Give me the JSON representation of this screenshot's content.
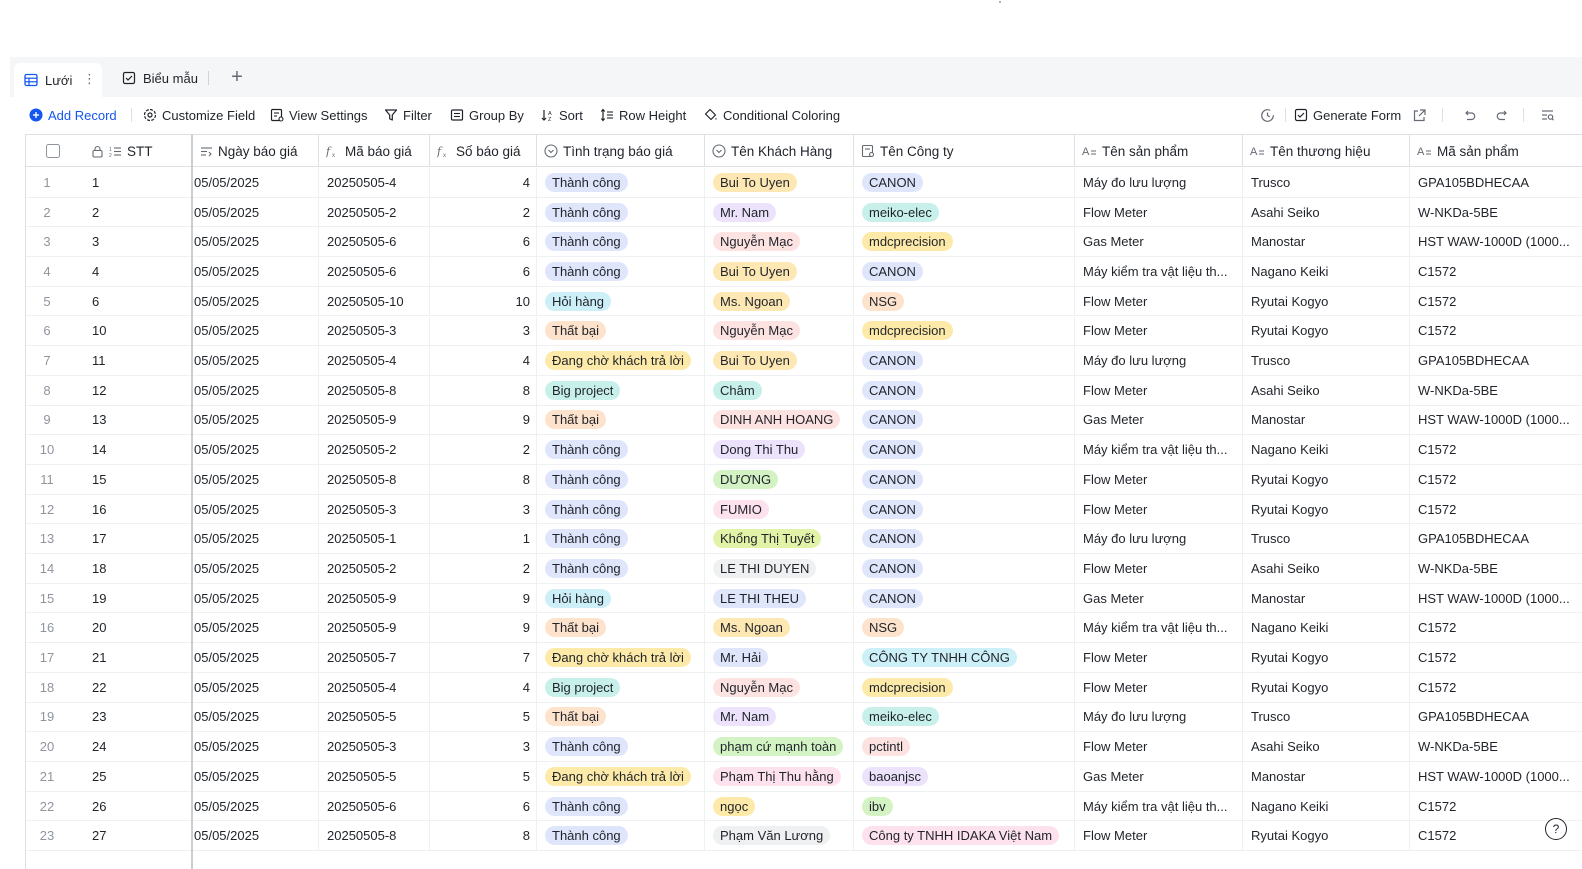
{
  "tabs": {
    "grid_label": "Lưới",
    "form_label": "Biểu mẫu",
    "more_glyph": "⋮",
    "add_glyph": "+"
  },
  "toolbar": {
    "add_record": "Add Record",
    "customize_field": "Customize Field",
    "view_settings": "View Settings",
    "filter": "Filter",
    "group_by": "Group By",
    "sort": "Sort",
    "row_height": "Row Height",
    "conditional_coloring": "Conditional Coloring",
    "generate_form": "Generate Form"
  },
  "columns": {
    "stt": "STT",
    "ngay_bao_gia": "Ngày báo giá",
    "ma_bao_gia": "Mã báo giá",
    "so_bao_gia": "Số báo giá",
    "tinh_trang": "Tình trạng báo giá",
    "ten_khach_hang": "Tên Khách Hàng",
    "ten_cong_ty": "Tên Công ty",
    "ten_san_pham": "Tên sản phẩm",
    "ten_thuong_hieu": "Tên thương hiệu",
    "ma_san_pham": "Mã sản phẩm"
  },
  "status_colors": {
    "Thành công": "#dfe5fb",
    "Hỏi hàng": "#cdeff7",
    "Thất bại": "#fde2cc",
    "Đang chờ khách trả lời": "#fdeaa8",
    "Big project": "#c8f0ea"
  },
  "rows": [
    {
      "idx": "1",
      "stt": "1",
      "date": "05/05/2025",
      "code": "20250505-4",
      "no": "4",
      "status": "Thành công",
      "customer": "Bui To Uyen",
      "customer_color": "#fde8b3",
      "company": "CANON",
      "company_color": "#dfe5fb",
      "product": "Máy đo lưu lượng",
      "brand": "Trusco",
      "sku": "GPA105BDHECAA"
    },
    {
      "idx": "2",
      "stt": "2",
      "date": "05/05/2025",
      "code": "20250505-2",
      "no": "2",
      "status": "Thành công",
      "customer": "Mr. Nam",
      "customer_color": "#ece2fb",
      "company": "meiko-elec",
      "company_color": "#c8f0ea",
      "product": "Flow Meter",
      "brand": "Asahi Seiko",
      "sku": "W-NKDa-5BE"
    },
    {
      "idx": "3",
      "stt": "3",
      "date": "05/05/2025",
      "code": "20250505-6",
      "no": "6",
      "status": "Thành công",
      "customer": "Nguyễn Mạc",
      "customer_color": "#fde2e2",
      "company": "mdcprecision",
      "company_color": "#fdeaa8",
      "product": "Gas Meter",
      "brand": "Manostar",
      "sku": "HST WAW-1000D (1000..."
    },
    {
      "idx": "4",
      "stt": "4",
      "date": "05/05/2025",
      "code": "20250505-6",
      "no": "6",
      "status": "Thành công",
      "customer": "Bui To Uyen",
      "customer_color": "#fde8b3",
      "company": "CANON",
      "company_color": "#dfe5fb",
      "product": "Máy kiểm tra vật liệu th...",
      "brand": "Nagano Keiki",
      "sku": "C1572"
    },
    {
      "idx": "5",
      "stt": "6",
      "date": "05/05/2025",
      "code": "20250505-10",
      "no": "10",
      "status": "Hỏi hàng",
      "customer": "Ms. Ngoan",
      "customer_color": "#fde8b3",
      "company": "NSG",
      "company_color": "#fde2cc",
      "product": "Flow Meter",
      "brand": "Ryutai Kogyo",
      "sku": "C1572"
    },
    {
      "idx": "6",
      "stt": "10",
      "date": "05/05/2025",
      "code": "20250505-3",
      "no": "3",
      "status": "Thất bại",
      "customer": "Nguyễn Mạc",
      "customer_color": "#fde2e2",
      "company": "mdcprecision",
      "company_color": "#fdeaa8",
      "product": "Flow Meter",
      "brand": "Ryutai Kogyo",
      "sku": "C1572"
    },
    {
      "idx": "7",
      "stt": "11",
      "date": "05/05/2025",
      "code": "20250505-4",
      "no": "4",
      "status": "Đang chờ khách trả lời",
      "customer": "Bui To Uyen",
      "customer_color": "#fde8b3",
      "company": "CANON",
      "company_color": "#dfe5fb",
      "product": "Máy đo lưu lượng",
      "brand": "Trusco",
      "sku": "GPA105BDHECAA"
    },
    {
      "idx": "8",
      "stt": "12",
      "date": "05/05/2025",
      "code": "20250505-8",
      "no": "8",
      "status": "Big project",
      "customer": "Châm",
      "customer_color": "#c8f0ea",
      "company": "CANON",
      "company_color": "#dfe5fb",
      "product": "Flow Meter",
      "brand": "Asahi Seiko",
      "sku": "W-NKDa-5BE"
    },
    {
      "idx": "9",
      "stt": "13",
      "date": "05/05/2025",
      "code": "20250505-9",
      "no": "9",
      "status": "Thất bại",
      "customer": "DINH ANH HOANG",
      "customer_color": "#fde2e2",
      "company": "CANON",
      "company_color": "#dfe5fb",
      "product": "Gas Meter",
      "brand": "Manostar",
      "sku": "HST WAW-1000D (1000..."
    },
    {
      "idx": "10",
      "stt": "14",
      "date": "05/05/2025",
      "code": "20250505-2",
      "no": "2",
      "status": "Thành công",
      "customer": "Dong Thi Thu",
      "customer_color": "#ece2fb",
      "company": "CANON",
      "company_color": "#dfe5fb",
      "product": "Máy kiểm tra vật liệu th...",
      "brand": "Nagano Keiki",
      "sku": "C1572"
    },
    {
      "idx": "11",
      "stt": "15",
      "date": "05/05/2025",
      "code": "20250505-8",
      "no": "8",
      "status": "Thành công",
      "customer": "DƯƠNG",
      "customer_color": "#d4f3c4",
      "company": "CANON",
      "company_color": "#dfe5fb",
      "product": "Flow Meter",
      "brand": "Ryutai Kogyo",
      "sku": "C1572"
    },
    {
      "idx": "12",
      "stt": "16",
      "date": "05/05/2025",
      "code": "20250505-3",
      "no": "3",
      "status": "Thành công",
      "customer": "FUMIO",
      "customer_color": "#fde2ee",
      "company": "CANON",
      "company_color": "#dfe5fb",
      "product": "Flow Meter",
      "brand": "Ryutai Kogyo",
      "sku": "C1572"
    },
    {
      "idx": "13",
      "stt": "17",
      "date": "05/05/2025",
      "code": "20250505-1",
      "no": "1",
      "status": "Thành công",
      "customer": "Khổng Thị Tuyết",
      "customer_color": "#e2f3a8",
      "company": "CANON",
      "company_color": "#dfe5fb",
      "product": "Máy đo lưu lượng",
      "brand": "Trusco",
      "sku": "GPA105BDHECAA"
    },
    {
      "idx": "14",
      "stt": "18",
      "date": "05/05/2025",
      "code": "20250505-2",
      "no": "2",
      "status": "Thành công",
      "customer": "LE THI DUYEN",
      "customer_color": "#eff0f1",
      "company": "CANON",
      "company_color": "#dfe5fb",
      "product": "Flow Meter",
      "brand": "Asahi Seiko",
      "sku": "W-NKDa-5BE"
    },
    {
      "idx": "15",
      "stt": "19",
      "date": "05/05/2025",
      "code": "20250505-9",
      "no": "9",
      "status": "Hỏi hàng",
      "customer": "LE THI THEU",
      "customer_color": "#dfe5fb",
      "company": "CANON",
      "company_color": "#dfe5fb",
      "product": "Gas Meter",
      "brand": "Manostar",
      "sku": "HST WAW-1000D (1000..."
    },
    {
      "idx": "16",
      "stt": "20",
      "date": "05/05/2025",
      "code": "20250505-9",
      "no": "9",
      "status": "Thất bại",
      "customer": "Ms. Ngoan",
      "customer_color": "#fde8b3",
      "company": "NSG",
      "company_color": "#fde2cc",
      "product": "Máy kiểm tra vật liệu th...",
      "brand": "Nagano Keiki",
      "sku": "C1572"
    },
    {
      "idx": "17",
      "stt": "21",
      "date": "05/05/2025",
      "code": "20250505-7",
      "no": "7",
      "status": "Đang chờ khách trả lời",
      "customer": "Mr. Hải",
      "customer_color": "#dfe5fb",
      "company": "CÔNG TY TNHH CÔNG",
      "company_color": "#cdeff7",
      "product": "Flow Meter",
      "brand": "Ryutai Kogyo",
      "sku": "C1572"
    },
    {
      "idx": "18",
      "stt": "22",
      "date": "05/05/2025",
      "code": "20250505-4",
      "no": "4",
      "status": "Big project",
      "customer": "Nguyễn Mạc",
      "customer_color": "#fde2e2",
      "company": "mdcprecision",
      "company_color": "#fdeaa8",
      "product": "Flow Meter",
      "brand": "Ryutai Kogyo",
      "sku": "C1572"
    },
    {
      "idx": "19",
      "stt": "23",
      "date": "05/05/2025",
      "code": "20250505-5",
      "no": "5",
      "status": "Thất bại",
      "customer": "Mr. Nam",
      "customer_color": "#ece2fb",
      "company": "meiko-elec",
      "company_color": "#c8f0ea",
      "product": "Máy đo lưu lượng",
      "brand": "Trusco",
      "sku": "GPA105BDHECAA"
    },
    {
      "idx": "20",
      "stt": "24",
      "date": "05/05/2025",
      "code": "20250505-3",
      "no": "3",
      "status": "Thành công",
      "customer": "phạm cứ mạnh toàn",
      "customer_color": "#d4f3c4",
      "company": "pctintl",
      "company_color": "#fde2e2",
      "product": "Flow Meter",
      "brand": "Asahi Seiko",
      "sku": "W-NKDa-5BE"
    },
    {
      "idx": "21",
      "stt": "25",
      "date": "05/05/2025",
      "code": "20250505-5",
      "no": "5",
      "status": "Đang chờ khách trả lời",
      "customer": "Phạm Thị Thu hằng",
      "customer_color": "#fde2ee",
      "company": "baoanjsc",
      "company_color": "#ece2fb",
      "product": "Gas Meter",
      "brand": "Manostar",
      "sku": "HST WAW-1000D (1000..."
    },
    {
      "idx": "22",
      "stt": "26",
      "date": "05/05/2025",
      "code": "20250505-6",
      "no": "6",
      "status": "Thành công",
      "customer": "ngọc",
      "customer_color": "#fdeaa8",
      "company": "ibv",
      "company_color": "#d4f3c4",
      "product": "Máy kiểm tra vật liệu th...",
      "brand": "Nagano Keiki",
      "sku": "C1572"
    },
    {
      "idx": "23",
      "stt": "27",
      "date": "05/05/2025",
      "code": "20250505-8",
      "no": "8",
      "status": "Thành công",
      "customer": "Phạm Văn Lương",
      "customer_color": "#eff0f1",
      "company": "Công ty TNHH IDAKA Việt Nam",
      "company_color": "#fde2ee",
      "product": "Flow Meter",
      "brand": "Ryutai Kogyo",
      "sku": "C1572"
    }
  ],
  "help_glyph": "?"
}
